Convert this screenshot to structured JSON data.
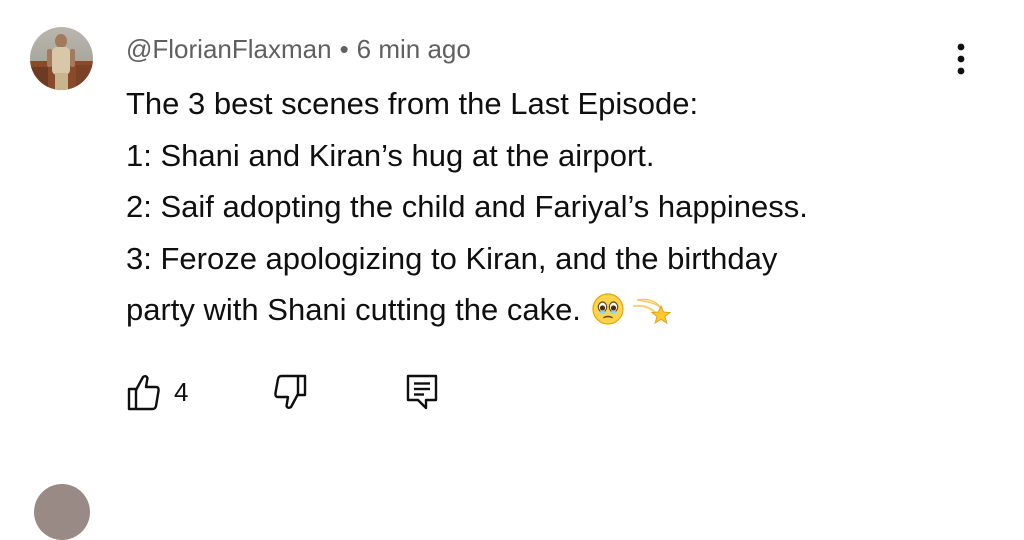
{
  "comment": {
    "handle": "@FlorianFlaxman",
    "separator": "•",
    "time": "6 min ago",
    "lines": [
      "The 3 best scenes from the Last Episode:",
      "1: Shani and Kiran’s hug at the airport.",
      "2: Saif adopting the child and Fariyal’s happiness.",
      "3: Feroze apologizing to Kiran, and the birthday",
      "party with Shani cutting the cake."
    ],
    "emojis": [
      "teary-face-emoji",
      "dizzy-star-emoji"
    ],
    "like_count": "4"
  },
  "icons": {
    "like": "thumbs-up-icon",
    "dislike": "thumbs-down-icon",
    "reply": "reply-comment-icon",
    "menu": "more-vertical-icon"
  },
  "colors": {
    "text_primary": "#0f0f0f",
    "text_secondary": "#606060",
    "background": "#ffffff"
  }
}
